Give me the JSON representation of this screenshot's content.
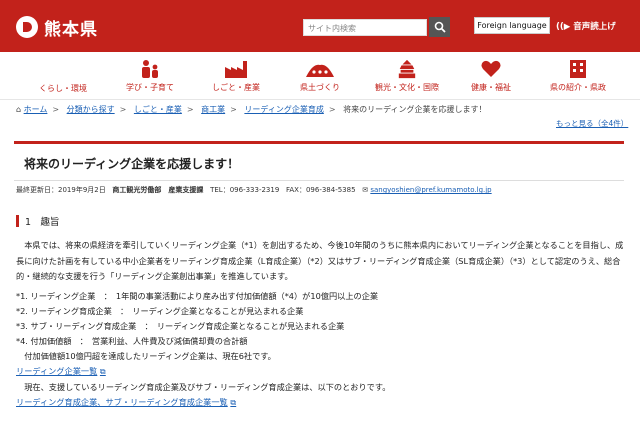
{
  "header": {
    "site_name": "熊本県",
    "search_placeholder": "サイト内検索",
    "foreign_language": "Foreign language",
    "read_aloud": "音声読上げ"
  },
  "nav": [
    {
      "label": "くらし・環境",
      "icon": "none"
    },
    {
      "label": "学び・子育て",
      "icon": "family-icon"
    },
    {
      "label": "しごと・産業",
      "icon": "factory-icon"
    },
    {
      "label": "県土づくり",
      "icon": "mountain-icon"
    },
    {
      "label": "観光・文化・国際",
      "icon": "castle-icon"
    },
    {
      "label": "健康・福祉",
      "icon": "heart-hand-icon"
    },
    {
      "label": "県の紹介・県政",
      "icon": "building-icon"
    }
  ],
  "breadcrumb": {
    "home": "ホーム",
    "items": [
      "分類から探す",
      "しごと・産業",
      "商工業",
      "リーディング企業育成"
    ],
    "current": "将来のリーディング企業を応援します！",
    "more": "もっと見る（全4件）"
  },
  "page": {
    "title": "将来のリーディング企業を応援します！",
    "updated": "最終更新日：2019年9月2日",
    "dept": "商工観光労働部　産業支援課",
    "tel": "TEL：096-333-2319",
    "fax": "FAX：096-384-5385",
    "email": "sangyoshien@pref.kumamoto.lg.jp",
    "section_title": "1　趣旨",
    "para1": "　本県では、将来の県経済を牽引していくリーディング企業（*1）を創出するため、今後10年間のうちに熊本県内においてリーディング企業となることを目指し、成長に向けた計画を有している中小企業者をリーディング育成企業（L育成企業）（*2）又はサブ・リーディング育成企業（SL育成企業）（*3）として認定のうえ、総合的・継続的な支援を行う「リーディング企業創出事業」を推進しています。",
    "note1": "*1. リーディング企業　：　1年間の事業活動により産み出す付加価値額（*4）が10億円以上の企業",
    "note2": "*2. リーディング育成企業　：　リーディング企業となることが見込まれる企業",
    "note3": "*3. サブ・リーディング育成企業　：　リーディング育成企業となることが見込まれる企業",
    "note4": "*4. 付加価値額　：　営業利益、人件費及び減価償却費の合計額",
    "para2": "　付加価値額10億円超を達成したリーディング企業は、現在6社です。",
    "link1": "リーディング企業一覧",
    "para3": "　現在、支援しているリーディング育成企業及びサブ・リーディング育成企業は、以下のとおりです。",
    "link2": "リーディング育成企業、サブ・リーディング育成企業一覧"
  }
}
